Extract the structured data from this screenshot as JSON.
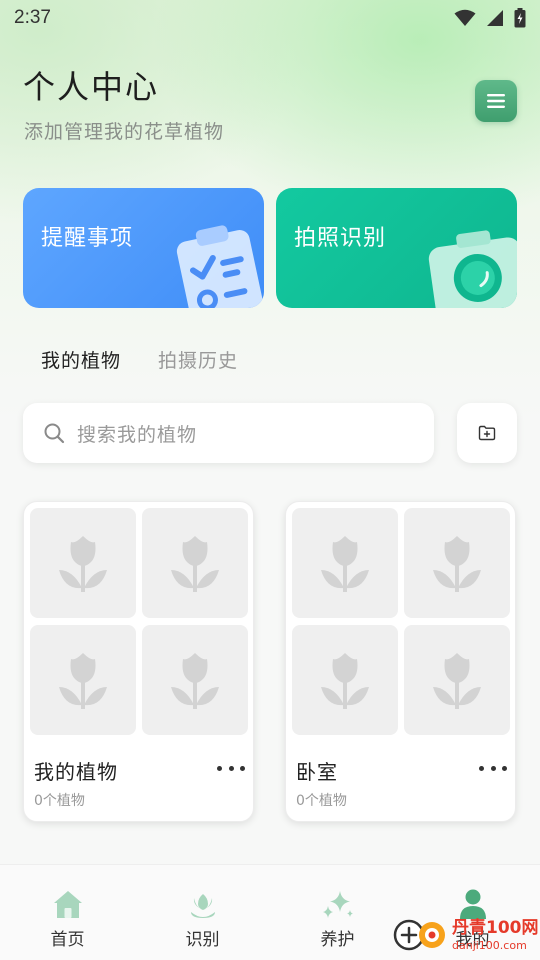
{
  "status_bar": {
    "time": "2:37",
    "icons": [
      "wifi-icon",
      "signal-icon",
      "battery-charging-icon"
    ]
  },
  "header": {
    "title": "个人中心",
    "subtitle": "添加管理我的花草植物",
    "menu_icon": "menu-icon"
  },
  "action_cards": {
    "reminder": {
      "label": "提醒事项",
      "icon": "clipboard-checklist-icon",
      "color": "#4A97FC"
    },
    "identify": {
      "label": "拍照识别",
      "icon": "camera-icon",
      "color": "#12C19A"
    }
  },
  "tabs": [
    {
      "label": "我的植物",
      "active": true
    },
    {
      "label": "拍摄历史",
      "active": false
    }
  ],
  "search": {
    "placeholder": "搜索我的植物",
    "icon": "search-icon",
    "add_button_icon": "add-folder-icon"
  },
  "albums": [
    {
      "name": "我的植物",
      "count": "0个植物",
      "thumbs": 4
    },
    {
      "name": "卧室",
      "count": "0个植物",
      "thumbs": 4
    }
  ],
  "bottom_nav": [
    {
      "label": "首页",
      "icon": "home-icon"
    },
    {
      "label": "识别",
      "icon": "plant-scan-icon"
    },
    {
      "label": "养护",
      "icon": "sparkle-icon"
    },
    {
      "label": "我的",
      "icon": "user-icon",
      "active": true
    }
  ],
  "colors": {
    "accent_green": "#4CAA7C",
    "nav_icon_green": "#9ED0B4"
  },
  "watermark": {
    "line1": "丹青100网",
    "line2": "danji100.com"
  }
}
